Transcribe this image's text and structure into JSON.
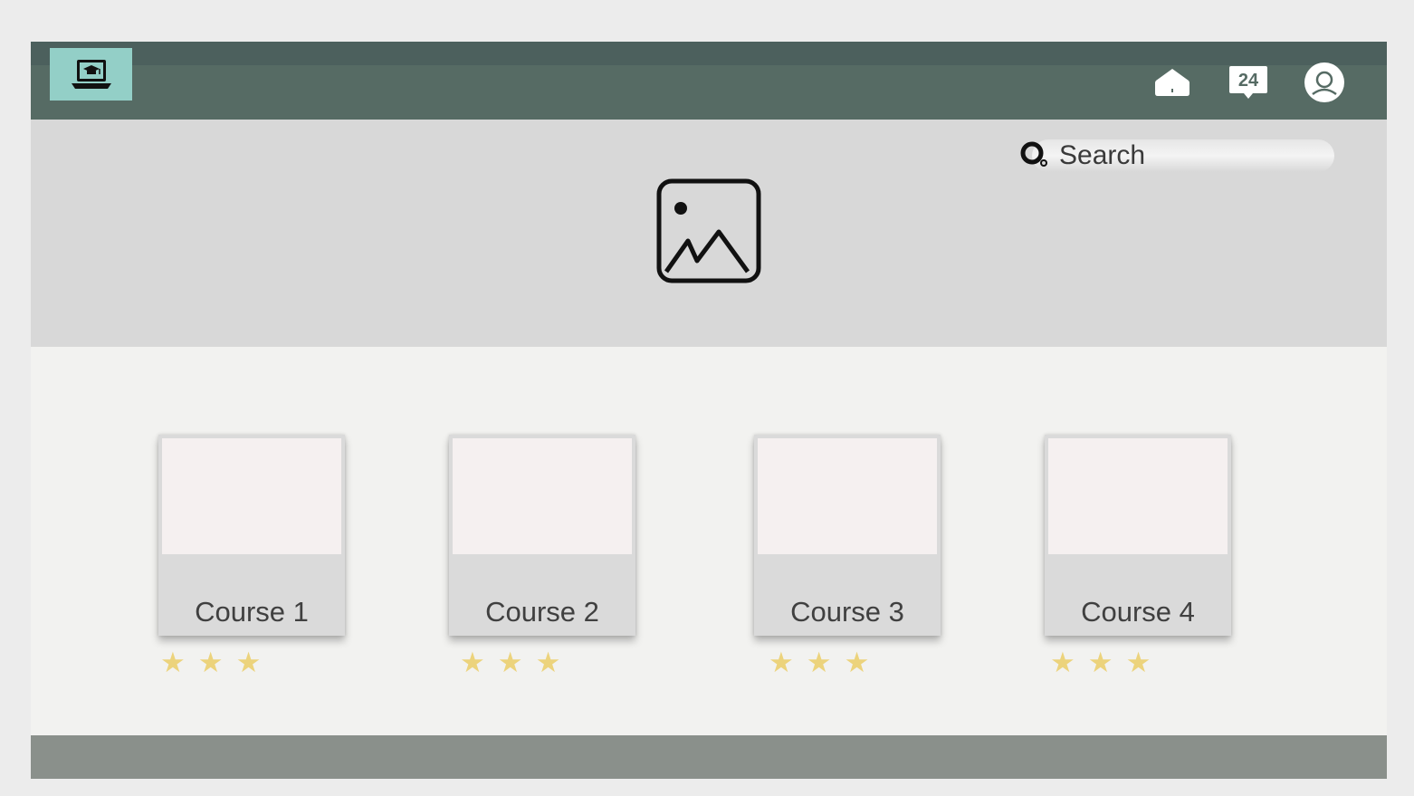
{
  "header": {
    "logo_icon": "laptop-graduation-cap-icon",
    "nav_icons": [
      "home-icon",
      "24-hour-support-icon",
      "user-account-icon"
    ],
    "colors": {
      "topbar": "#566b64",
      "logo_bg": "#93cfc7"
    }
  },
  "hero": {
    "image_icon": "image-placeholder-icon",
    "search": {
      "icon": "search-icon",
      "placeholder": "Search"
    },
    "colors": {
      "background": "#d8d8d8"
    }
  },
  "courses": [
    {
      "title": "Course 1",
      "stars": 3
    },
    {
      "title": "Course 2",
      "stars": 3
    },
    {
      "title": "Course 3",
      "stars": 3
    },
    {
      "title": "Course 4",
      "stars": 3
    }
  ],
  "footer": {
    "colors": {
      "background": "#8a908b"
    }
  },
  "accent_colors": {
    "star": "#ecd37c"
  }
}
